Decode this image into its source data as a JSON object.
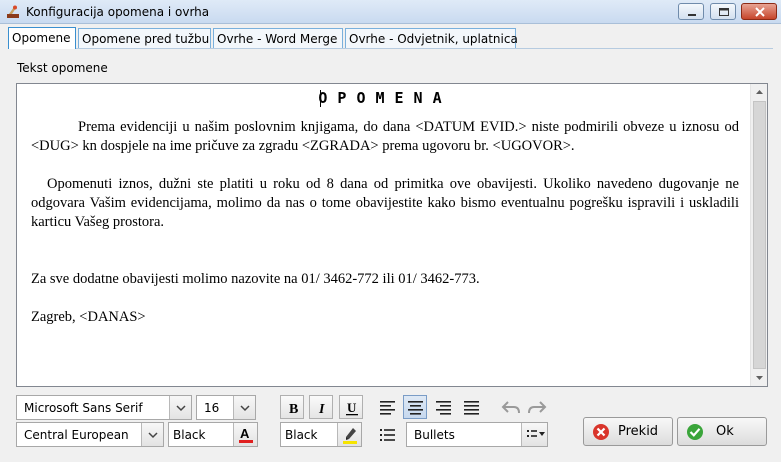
{
  "window": {
    "title": "Konfiguracija opomena i ovrha"
  },
  "tabs": [
    {
      "label": "Opomene",
      "active": true
    },
    {
      "label": "Opomene pred tužbu",
      "active": false
    },
    {
      "label": "Ovrhe - Word Merge",
      "active": false
    },
    {
      "label": "Ovrhe - Odvjetnik, uplatnica",
      "active": false
    }
  ],
  "editor": {
    "label": "Tekst opomene",
    "heading": "OPOMENA",
    "paragraphs": [
      "Prema evidenciji u našim poslovnim knjigama, do dana <DATUM EVID.> niste podmirili obveze u iznosu od <DUG> kn dospjele na ime pričuve za zgradu <ZGRADA> prema ugovoru br. <UGOVOR>.",
      "Opomenuti iznos, dužni ste platiti u roku od 8 dana od primitka ove obavijesti. Ukoliko navedeno dugovanje ne odgovara Vašim evidencijama, molimo da nas o tome obavijestite kako bismo eventualnu pogrešku ispravili i uskladili karticu Vašeg prostora.",
      "Za sve dodatne obavijesti molimo nazovite na 01/ 3462-772 ili 01/ 3462-773.",
      "Zagreb, <DANAS>"
    ]
  },
  "toolbar": {
    "font_family": "Microsoft Sans Serif",
    "font_size": "16",
    "charset": "Central European",
    "text_color": "Black",
    "highlight_color": "Black",
    "list_style": "Bullets",
    "bold_label": "B",
    "italic_label": "I",
    "underline_label": "U"
  },
  "buttons": {
    "cancel": "Prekid",
    "ok": "Ok"
  },
  "colors": {
    "tab_border": "#7ab0dc",
    "cancel_icon": "#d9352b",
    "ok_icon": "#3aa53a"
  }
}
